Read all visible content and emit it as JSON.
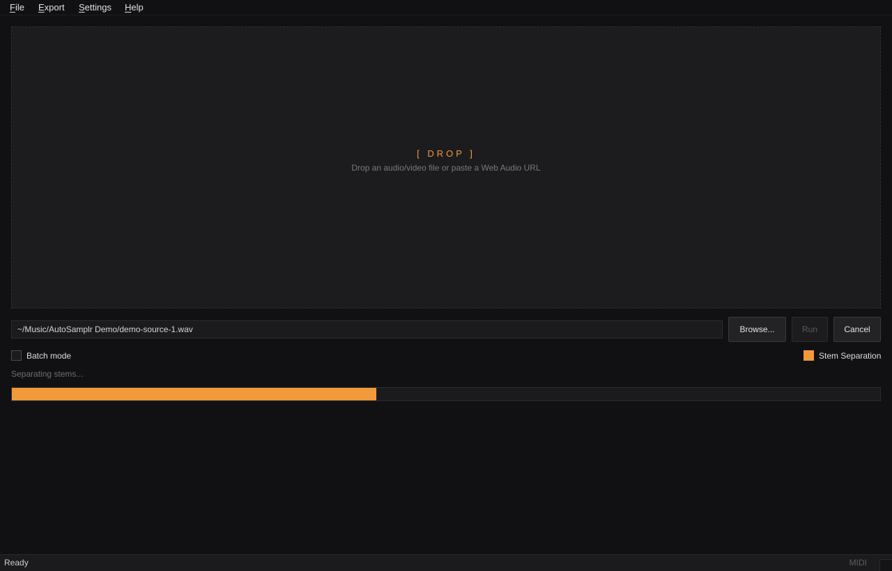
{
  "menu": {
    "file": {
      "first": "F",
      "rest": "ile"
    },
    "export": {
      "first": "E",
      "rest": "xport"
    },
    "settings": {
      "first": "S",
      "rest": "ettings"
    },
    "help": {
      "first": "H",
      "rest": "elp"
    }
  },
  "dropzone": {
    "title": "[ DROP ]",
    "hint": "Drop an audio/video file or paste a Web Audio URL"
  },
  "source": {
    "path_value": "~/Music/AutoSamplr Demo/demo-source-1.wav"
  },
  "buttons": {
    "browse": "Browse...",
    "run": "Run",
    "cancel": "Cancel"
  },
  "options": {
    "batch_mode": {
      "label": "Batch mode",
      "checked": false
    },
    "stem_separation": {
      "label": "Stem Separation",
      "checked": true
    }
  },
  "progress": {
    "message": "Separating stems...",
    "fraction": 0.42
  },
  "statusbar": {
    "left": "Ready",
    "right": "MIDI"
  },
  "colors": {
    "accent": "#f29a3a",
    "background": "#111113",
    "panel": "#1c1c1f"
  }
}
